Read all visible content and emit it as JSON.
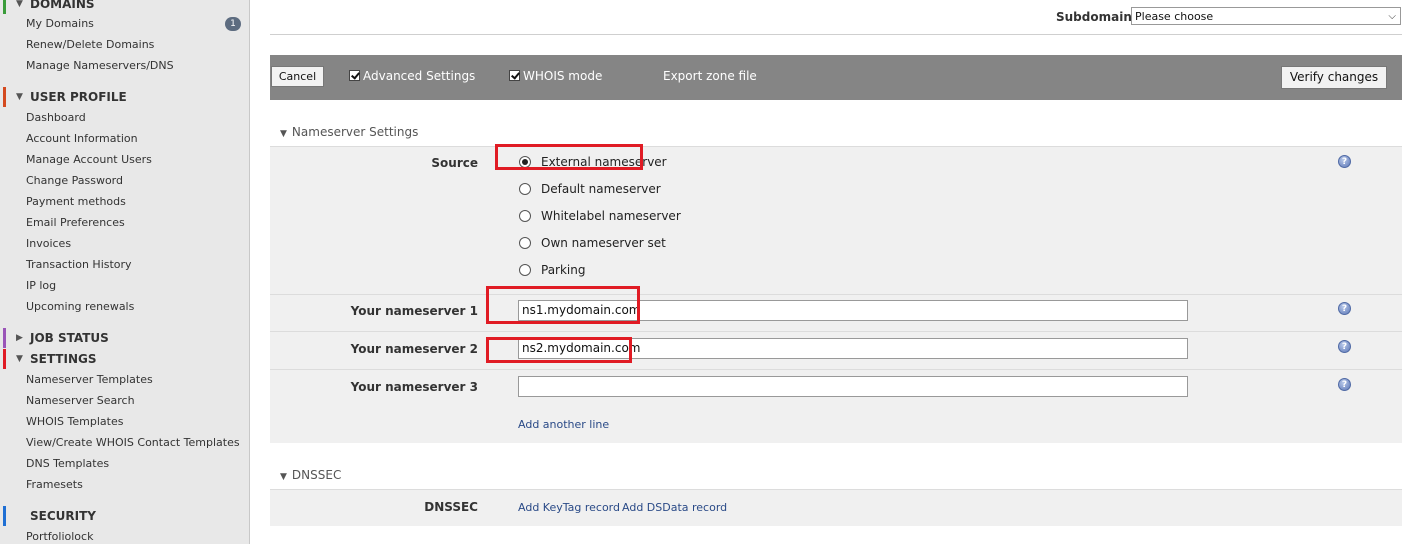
{
  "sidebar": {
    "domains": {
      "title": "DOMAINS",
      "color": "#3a9c3a",
      "items": [
        "My Domains",
        "Renew/Delete Domains",
        "Manage Nameservers/DNS"
      ],
      "badge": "1"
    },
    "user_profile": {
      "title": "USER PROFILE",
      "color": "#d44a1f",
      "items": [
        "Dashboard",
        "Account Information",
        "Manage Account Users",
        "Change Password",
        "Payment methods",
        "Email Preferences",
        "Invoices",
        "Transaction History",
        "IP log",
        "Upcoming renewals"
      ]
    },
    "job_status": {
      "title": "JOB STATUS",
      "color": "#9a55b8"
    },
    "settings": {
      "title": "SETTINGS",
      "color": "#e01b24",
      "items": [
        "Nameserver Templates",
        "Nameserver Search",
        "WHOIS Templates",
        "View/Create WHOIS Contact Templates",
        "DNS Templates",
        "Framesets"
      ]
    },
    "security": {
      "title": "SECURITY",
      "color": "#1f6fd4",
      "items": [
        "Portfoliolock"
      ]
    }
  },
  "header": {
    "subdomains_label": "Subdomains",
    "subdomains_value": "Please choose"
  },
  "toolbar": {
    "cancel": "Cancel",
    "advanced_settings": "Advanced Settings",
    "whois_mode": "WHOIS mode",
    "export_zone": "Export zone file",
    "verify": "Verify changes"
  },
  "nameserver_settings": {
    "title": "Nameserver Settings",
    "source_label": "Source",
    "options": [
      "External nameserver",
      "Default nameserver",
      "Whitelabel nameserver",
      "Own nameserver set",
      "Parking"
    ],
    "selected": "External nameserver",
    "ns1_label": "Your nameserver 1",
    "ns1_value": "ns1.mydomain.com",
    "ns2_label": "Your nameserver 2",
    "ns2_value": "ns2.mydomain.com",
    "ns3_label": "Your nameserver 3",
    "ns3_value": "",
    "add_line": "Add another line"
  },
  "dnssec": {
    "title": "DNSSEC",
    "label": "DNSSEC",
    "add_keytag": "Add KeyTag record",
    "add_dsdata": "Add DSData record"
  },
  "help_icon_glyph": "?"
}
